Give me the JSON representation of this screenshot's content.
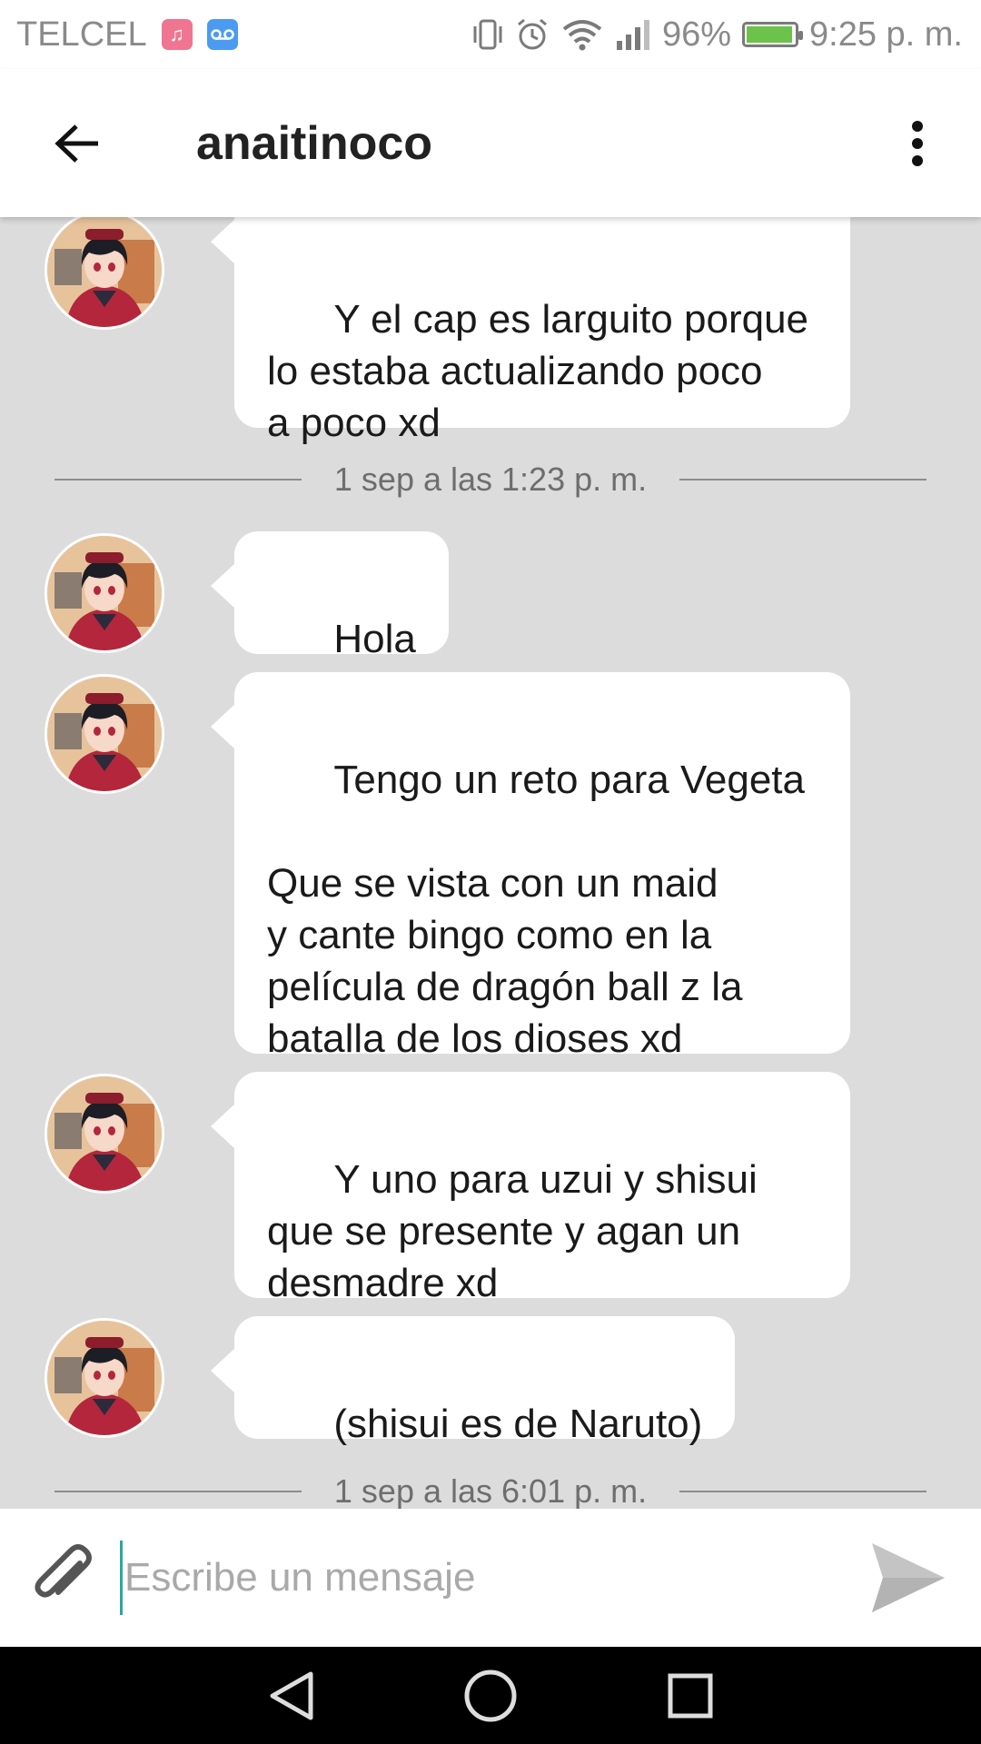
{
  "status_bar": {
    "carrier": "TELCEL",
    "battery_percent": "96%",
    "battery_level": 0.96,
    "time": "9:25 p. m.",
    "icons": [
      "music-app-icon",
      "voicemail-icon",
      "vibrate-icon",
      "alarm-icon",
      "wifi-icon",
      "signal-icon",
      "battery-icon"
    ]
  },
  "header": {
    "title": "anaitinoco",
    "back_icon": "arrow-left-icon",
    "menu_icon": "more-vertical-icon"
  },
  "messages": [
    {
      "type": "message",
      "text": "Y el cap es larguito porque\nlo estaba actualizando poco\na poco xd"
    },
    {
      "type": "divider",
      "text": "1 sep a las 1:23 p. m."
    },
    {
      "type": "message",
      "text": "Hola"
    },
    {
      "type": "message",
      "text": "Tengo un reto para Vegeta\n\nQue se vista con un maid\ny cante bingo como en la\npelícula de dragón ball z la\nbatalla de los dioses xd"
    },
    {
      "type": "message",
      "text": "Y uno para uzui y shisui\nque se presente y agan un\ndesmadre xd"
    },
    {
      "type": "message",
      "text": "(shisui es de Naruto)"
    },
    {
      "type": "divider",
      "text": "1 sep a las 6:01 p. m."
    }
  ],
  "composer": {
    "placeholder": "Escribe un mensaje",
    "value": ""
  },
  "colors": {
    "chat_background": "#dcdcdc",
    "bubble": "#ffffff",
    "cursor": "#2aa7a0",
    "battery_fill": "#6cc24a"
  }
}
